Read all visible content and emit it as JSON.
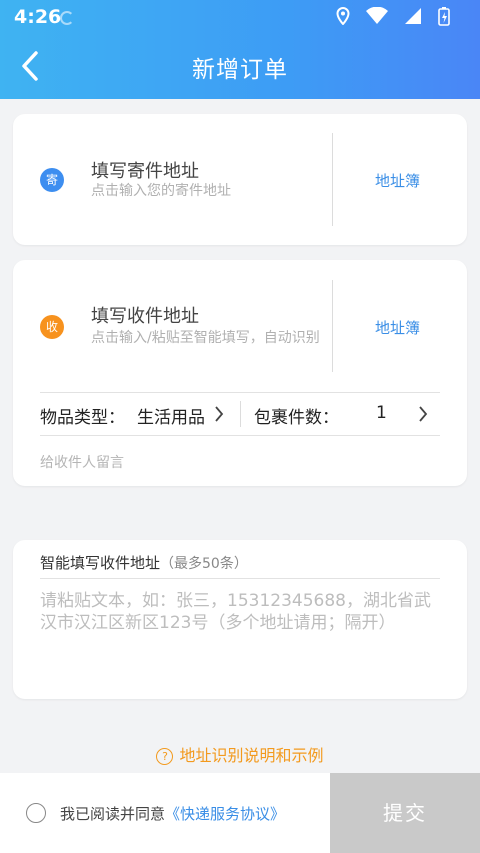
{
  "status_bar": {
    "time": "4:26"
  },
  "header": {
    "title": "新增订单"
  },
  "sender": {
    "badge": "寄",
    "title": "填写寄件地址",
    "hint": "点击输入您的寄件地址",
    "book": "地址簿",
    "badge_color": "#3d8ef0"
  },
  "receiver": {
    "badge": "收",
    "title": "填写收件地址",
    "hint": "点击输入/粘贴至智能填写，自动识别",
    "book": "地址簿",
    "badge_color": "#f7921e"
  },
  "item": {
    "type_label": "物品类型：",
    "type_value": "生活用品",
    "count_label": "包裹件数：",
    "count_value": "1",
    "note_placeholder": "给收件人留言"
  },
  "smart": {
    "title": "智能填写收件地址",
    "subtitle": "（最多50条）",
    "placeholder": "请粘贴文本，如：张三，15312345688，湖北省武汉市汉江区新区123号（多个地址请用；隔开）"
  },
  "help": {
    "text": "地址识别说明和示例",
    "color": "#f39a1e"
  },
  "footer": {
    "agree_text": "我已阅读并同意",
    "agree_link": "《快递服务协议》",
    "submit": "提交"
  }
}
